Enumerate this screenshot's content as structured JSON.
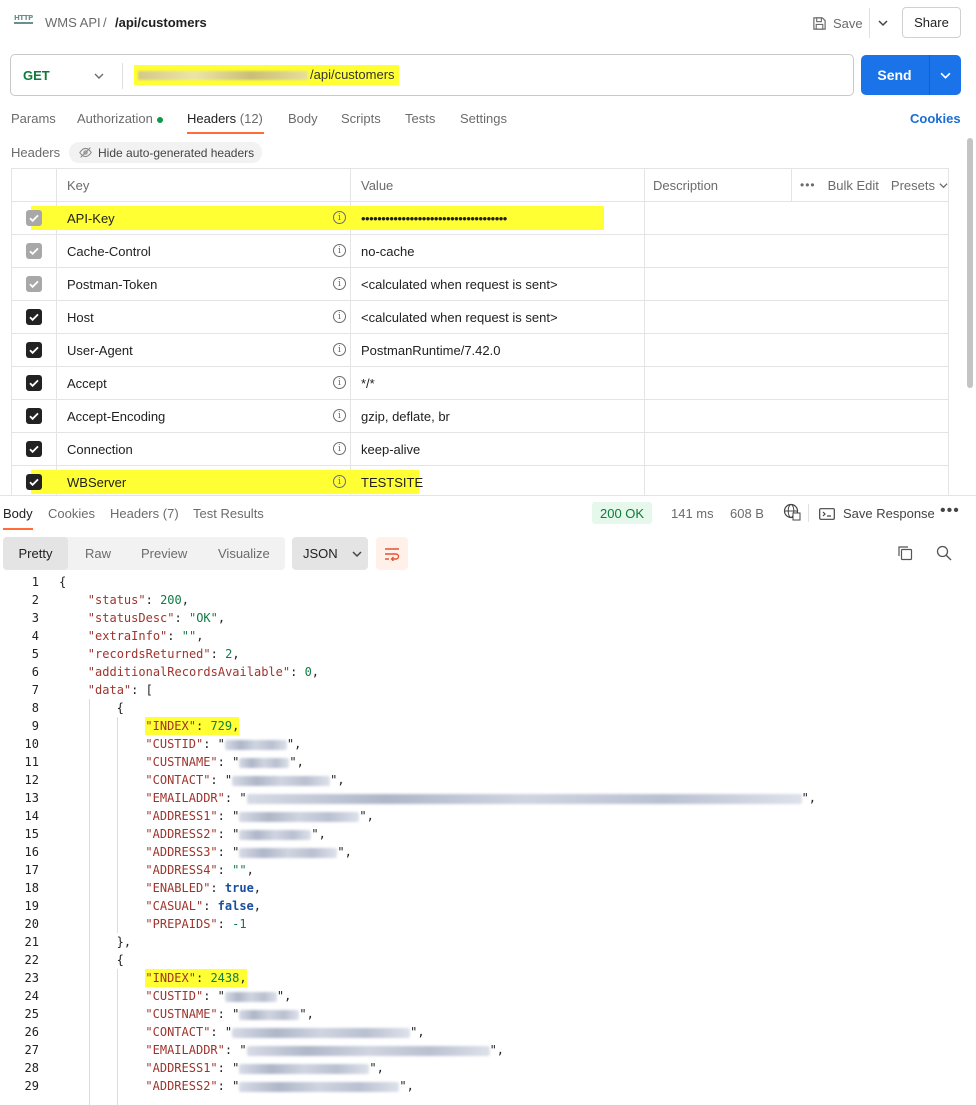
{
  "topbar": {
    "icon": "http-icon",
    "collection": "WMS API",
    "separator": "/",
    "request_name": "/api/customers",
    "save_label": "Save",
    "share_label": "Share"
  },
  "request": {
    "method": "GET",
    "url_suffix": "/api/customers",
    "send_label": "Send"
  },
  "request_tabs": [
    {
      "label": "Params"
    },
    {
      "label": "Authorization"
    },
    {
      "label": "Headers",
      "count": "(12)"
    },
    {
      "label": "Body"
    },
    {
      "label": "Scripts"
    },
    {
      "label": "Tests"
    },
    {
      "label": "Settings"
    }
  ],
  "cookies_label": "Cookies",
  "headers_section": {
    "title": "Headers",
    "hide_auto_label": "Hide auto-generated headers",
    "columns": {
      "key": "Key",
      "value": "Value",
      "description": "Description"
    },
    "bulk_edit": "Bulk Edit",
    "presets": "Presets",
    "rows": [
      {
        "key": "API-Key",
        "value": "••••••••••••••••••••••••••••••••••••",
        "checked": "grey",
        "highlight": true
      },
      {
        "key": "Cache-Control",
        "value": "no-cache",
        "checked": "grey"
      },
      {
        "key": "Postman-Token",
        "value": "<calculated when request is sent>",
        "checked": "grey"
      },
      {
        "key": "Host",
        "value": "<calculated when request is sent>",
        "checked": "black"
      },
      {
        "key": "User-Agent",
        "value": "PostmanRuntime/7.42.0",
        "checked": "black"
      },
      {
        "key": "Accept",
        "value": "*/*",
        "checked": "black"
      },
      {
        "key": "Accept-Encoding",
        "value": "gzip, deflate, br",
        "checked": "black"
      },
      {
        "key": "Connection",
        "value": "keep-alive",
        "checked": "black"
      },
      {
        "key": "WBServer",
        "value": "TESTSITE",
        "checked": "black",
        "highlight": true
      }
    ]
  },
  "response": {
    "tabs": [
      {
        "label": "Body"
      },
      {
        "label": "Cookies"
      },
      {
        "label": "Headers",
        "count": "(7)"
      },
      {
        "label": "Test Results"
      }
    ],
    "status": "200 OK",
    "time": "141 ms",
    "size": "608 B",
    "save_response": "Save Response",
    "view_modes": [
      "Pretty",
      "Raw",
      "Preview",
      "Visualize"
    ],
    "format": "JSON"
  },
  "code_lines": [
    {
      "n": "1",
      "text": "{"
    },
    {
      "n": "2",
      "text": "\"status\": 200,"
    },
    {
      "n": "3",
      "text": "\"statusDesc\": \"OK\","
    },
    {
      "n": "4",
      "text": "\"extraInfo\": \"\","
    },
    {
      "n": "5",
      "text": "\"recordsReturned\": 2,"
    },
    {
      "n": "6",
      "text": "\"additionalRecordsAvailable\": 0,"
    },
    {
      "n": "7",
      "text": "\"data\": ["
    },
    {
      "n": "8",
      "text": "{"
    },
    {
      "n": "9",
      "text": "\"INDEX\": 729,"
    },
    {
      "n": "10",
      "text": "\"CUSTID\":"
    },
    {
      "n": "11",
      "text": "\"CUSTNAME\":"
    },
    {
      "n": "12",
      "text": "\"CONTACT\":"
    },
    {
      "n": "13",
      "text": "\"EMAILADDR\":"
    },
    {
      "n": "14",
      "text": "\"ADDRESS1\":"
    },
    {
      "n": "15",
      "text": "\"ADDRESS2\":"
    },
    {
      "n": "16",
      "text": "\"ADDRESS3\":"
    },
    {
      "n": "17",
      "text": "\"ADDRESS4\": \"\","
    },
    {
      "n": "18",
      "text": "\"ENABLED\": true,"
    },
    {
      "n": "19",
      "text": "\"CASUAL\": false,"
    },
    {
      "n": "20",
      "text": "\"PREPAIDS\": -1"
    },
    {
      "n": "21",
      "text": "},"
    },
    {
      "n": "22",
      "text": "{"
    },
    {
      "n": "23",
      "text": "\"INDEX\": 2438,"
    },
    {
      "n": "24",
      "text": "\"CUSTID\":"
    },
    {
      "n": "25",
      "text": "\"CUSTNAME\":"
    },
    {
      "n": "26",
      "text": "\"CONTACT\":"
    },
    {
      "n": "27",
      "text": "\"EMAILADDR\":"
    },
    {
      "n": "28",
      "text": "\"ADDRESS1\":"
    },
    {
      "n": "29",
      "text": "\"ADDRESS2\":"
    }
  ],
  "colors": {
    "accent": "#ff6c37",
    "send": "#1a73e8",
    "highlight": "#ffff33",
    "status_ok": "#0e7a3a"
  }
}
